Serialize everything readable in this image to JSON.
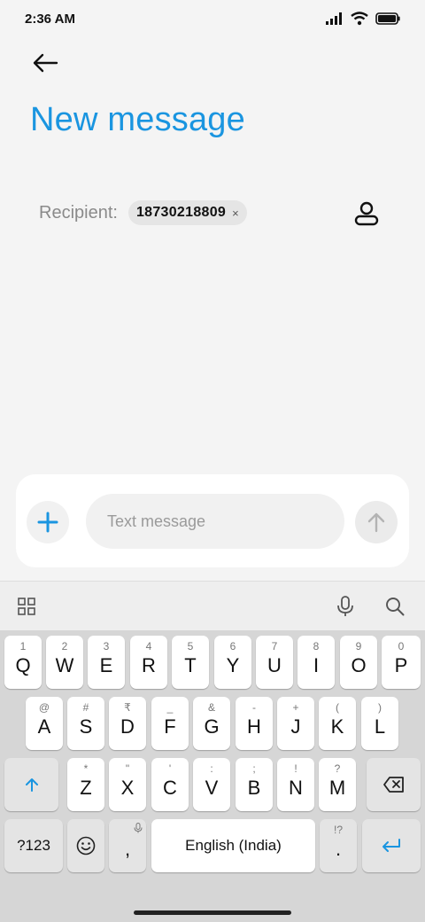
{
  "status": {
    "time": "2:36 AM"
  },
  "header": {
    "title": "New message"
  },
  "recipient": {
    "label": "Recipient:",
    "chip": "18730218809",
    "chip_close": "×"
  },
  "composer": {
    "placeholder": "Text message"
  },
  "keyboard": {
    "row1": [
      {
        "hint": "1",
        "key": "Q"
      },
      {
        "hint": "2",
        "key": "W"
      },
      {
        "hint": "3",
        "key": "E"
      },
      {
        "hint": "4",
        "key": "R"
      },
      {
        "hint": "5",
        "key": "T"
      },
      {
        "hint": "6",
        "key": "Y"
      },
      {
        "hint": "7",
        "key": "U"
      },
      {
        "hint": "8",
        "key": "I"
      },
      {
        "hint": "9",
        "key": "O"
      },
      {
        "hint": "0",
        "key": "P"
      }
    ],
    "row2": [
      {
        "hint": "@",
        "key": "A"
      },
      {
        "hint": "#",
        "key": "S"
      },
      {
        "hint": "₹",
        "key": "D"
      },
      {
        "hint": "_",
        "key": "F"
      },
      {
        "hint": "&",
        "key": "G"
      },
      {
        "hint": "-",
        "key": "H"
      },
      {
        "hint": "+",
        "key": "J"
      },
      {
        "hint": "(",
        "key": "K"
      },
      {
        "hint": ")",
        "key": "L"
      }
    ],
    "row3": [
      {
        "hint": "*",
        "key": "Z"
      },
      {
        "hint": "\"",
        "key": "X"
      },
      {
        "hint": "'",
        "key": "C"
      },
      {
        "hint": ":",
        "key": "V"
      },
      {
        "hint": ";",
        "key": "B"
      },
      {
        "hint": "!",
        "key": "N"
      },
      {
        "hint": "?",
        "key": "M"
      }
    ],
    "symbols_label": "?123",
    "comma": ",",
    "space_label": "English (India)",
    "period_hint": "!?",
    "period": "."
  },
  "colors": {
    "accent": "#1a95e0",
    "keyboard_bg": "#d6d6d6"
  },
  "icons": [
    "back-arrow-icon",
    "contact-icon",
    "plus-icon",
    "send-arrow-icon",
    "grid-icon",
    "mic-icon",
    "search-icon",
    "shift-icon",
    "backspace-icon",
    "emoji-icon",
    "enter-icon",
    "signal-icon",
    "wifi-icon",
    "battery-icon"
  ]
}
